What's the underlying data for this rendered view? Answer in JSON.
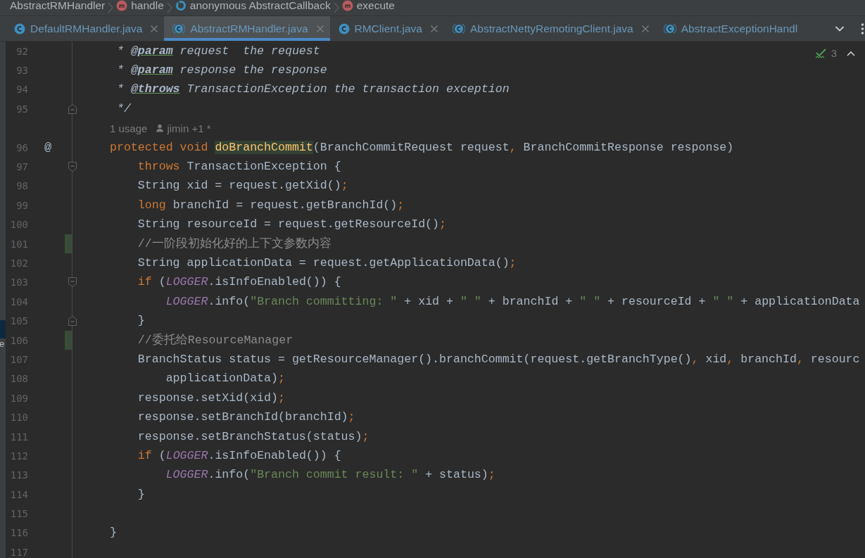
{
  "breadcrumbs": [
    {
      "label": "AbstractRMHandler",
      "kind": "plain"
    },
    {
      "label": "handle",
      "kind": "method"
    },
    {
      "label": "anonymous AbstractCallback",
      "kind": "anonymous"
    },
    {
      "label": "execute",
      "kind": "method"
    }
  ],
  "tabs": [
    {
      "label": "DefaultRMHandler.java",
      "kind": "class",
      "selected": false,
      "closable": true
    },
    {
      "label": "AbstractRMHandler.java",
      "kind": "abstract",
      "selected": true,
      "closable": true
    },
    {
      "label": "RMClient.java",
      "kind": "class",
      "selected": false,
      "closable": true
    },
    {
      "label": "AbstractNettyRemotingClient.java",
      "kind": "abstract",
      "selected": false,
      "closable": true
    },
    {
      "label": "AbstractExceptionHandl",
      "kind": "abstract",
      "selected": false,
      "closable": false
    }
  ],
  "left_stripe": {
    "label": "e"
  },
  "editor": {
    "inspection": {
      "count": "3"
    },
    "lines": [
      {
        "kind": "code",
        "number": "92",
        "tokens": [
          {
            "text": " * ",
            "kind": "doc"
          },
          {
            "text": "@param",
            "kind": "doctag"
          },
          {
            "text": " request  the request",
            "kind": "doc"
          }
        ]
      },
      {
        "kind": "code",
        "number": "93",
        "tokens": [
          {
            "text": " * ",
            "kind": "doc"
          },
          {
            "text": "@param",
            "kind": "doctag"
          },
          {
            "text": " response the response",
            "kind": "doc"
          }
        ]
      },
      {
        "kind": "code",
        "number": "94",
        "tokens": [
          {
            "text": " * ",
            "kind": "doc"
          },
          {
            "text": "@throws",
            "kind": "doctag"
          },
          {
            "text": " TransactionException the transaction exception",
            "kind": "doc"
          }
        ]
      },
      {
        "kind": "code",
        "number": "95",
        "fold_end": true,
        "tokens": [
          {
            "text": " */",
            "kind": "doc"
          }
        ]
      },
      {
        "kind": "inlay",
        "usage": "1 usage",
        "author": "jimin +1 *"
      },
      {
        "kind": "code",
        "number": "96",
        "gutter_mark": "@",
        "tokens": [
          {
            "text": "protected void ",
            "kind": "kw"
          },
          {
            "text": "doBranchCommit",
            "kind": "decl"
          },
          {
            "text": "(BranchCommitRequest request",
            "kind": "plain"
          },
          {
            "text": ", ",
            "kind": "punct"
          },
          {
            "text": "BranchCommitResponse response)",
            "kind": "plain"
          }
        ]
      },
      {
        "kind": "code",
        "number": "97",
        "fold_start": true,
        "tokens": [
          {
            "text": "    throws ",
            "kind": "kw"
          },
          {
            "text": "TransactionException {",
            "kind": "plain"
          }
        ]
      },
      {
        "kind": "code",
        "number": "98",
        "tokens": [
          {
            "text": "    String xid = request.getXid()",
            "kind": "plain"
          },
          {
            "text": ";",
            "kind": "punct"
          }
        ]
      },
      {
        "kind": "code",
        "number": "99",
        "tokens": [
          {
            "text": "    long ",
            "kind": "kw"
          },
          {
            "text": "branchId = request.getBranchId()",
            "kind": "plain"
          },
          {
            "text": ";",
            "kind": "punct"
          }
        ]
      },
      {
        "kind": "code",
        "number": "100",
        "tokens": [
          {
            "text": "    String resourceId = request.getResourceId()",
            "kind": "plain"
          },
          {
            "text": ";",
            "kind": "punct"
          }
        ]
      },
      {
        "kind": "code",
        "number": "101",
        "added": true,
        "tokens": [
          {
            "text": "    //一阶段初始化好的上下文参数内容",
            "kind": "cmt"
          }
        ]
      },
      {
        "kind": "code",
        "number": "102",
        "tokens": [
          {
            "text": "    String applicationData = request.getApplicationData()",
            "kind": "plain"
          },
          {
            "text": ";",
            "kind": "punct"
          }
        ]
      },
      {
        "kind": "code",
        "number": "103",
        "fold_start": true,
        "tokens": [
          {
            "text": "    if ",
            "kind": "kw"
          },
          {
            "text": "(",
            "kind": "plain"
          },
          {
            "text": "LOGGER",
            "kind": "static"
          },
          {
            "text": ".isInfoEnabled()) {",
            "kind": "plain"
          }
        ]
      },
      {
        "kind": "code",
        "number": "104",
        "tokens": [
          {
            "text": "        LOGGER",
            "kind": "static"
          },
          {
            "text": ".info(",
            "kind": "plain"
          },
          {
            "text": "\"Branch committing: \"",
            "kind": "str"
          },
          {
            "text": " + xid + ",
            "kind": "plain"
          },
          {
            "text": "\" \"",
            "kind": "str"
          },
          {
            "text": " + branchId + ",
            "kind": "plain"
          },
          {
            "text": "\" \"",
            "kind": "str"
          },
          {
            "text": " + resourceId + ",
            "kind": "plain"
          },
          {
            "text": "\" \"",
            "kind": "str"
          },
          {
            "text": " + applicationData",
            "kind": "plain"
          }
        ]
      },
      {
        "kind": "code",
        "number": "105",
        "fold_end": true,
        "tokens": [
          {
            "text": "    }",
            "kind": "plain"
          }
        ]
      },
      {
        "kind": "code",
        "number": "106",
        "added": true,
        "tokens": [
          {
            "text": "    //委托给ResourceManager",
            "kind": "cmt"
          }
        ]
      },
      {
        "kind": "code",
        "number": "107",
        "tokens": [
          {
            "text": "    BranchStatus status = getResourceManager().branchCommit(request.getBranchType()",
            "kind": "plain"
          },
          {
            "text": ", ",
            "kind": "punct"
          },
          {
            "text": "xid",
            "kind": "plain"
          },
          {
            "text": ", ",
            "kind": "punct"
          },
          {
            "text": "branchId",
            "kind": "plain"
          },
          {
            "text": ", ",
            "kind": "punct"
          },
          {
            "text": "resourc",
            "kind": "plain"
          }
        ]
      },
      {
        "kind": "code",
        "number": "108",
        "tokens": [
          {
            "text": "        applicationData)",
            "kind": "plain"
          },
          {
            "text": ";",
            "kind": "punct"
          }
        ]
      },
      {
        "kind": "code",
        "number": "109",
        "tokens": [
          {
            "text": "    response.setXid(xid)",
            "kind": "plain"
          },
          {
            "text": ";",
            "kind": "punct"
          }
        ]
      },
      {
        "kind": "code",
        "number": "110",
        "tokens": [
          {
            "text": "    response.setBranchId(branchId)",
            "kind": "plain"
          },
          {
            "text": ";",
            "kind": "punct"
          }
        ]
      },
      {
        "kind": "code",
        "number": "111",
        "tokens": [
          {
            "text": "    response.setBranchStatus(status)",
            "kind": "plain"
          },
          {
            "text": ";",
            "kind": "punct"
          }
        ]
      },
      {
        "kind": "code",
        "number": "112",
        "tokens": [
          {
            "text": "    if ",
            "kind": "kw"
          },
          {
            "text": "(",
            "kind": "plain"
          },
          {
            "text": "LOGGER",
            "kind": "static"
          },
          {
            "text": ".isInfoEnabled()) {",
            "kind": "plain"
          }
        ]
      },
      {
        "kind": "code",
        "number": "113",
        "tokens": [
          {
            "text": "        LOGGER",
            "kind": "static"
          },
          {
            "text": ".info(",
            "kind": "plain"
          },
          {
            "text": "\"Branch commit result: \"",
            "kind": "str"
          },
          {
            "text": " + status)",
            "kind": "plain"
          },
          {
            "text": ";",
            "kind": "punct"
          }
        ]
      },
      {
        "kind": "code",
        "number": "114",
        "tokens": [
          {
            "text": "    }",
            "kind": "plain"
          }
        ]
      },
      {
        "kind": "code",
        "number": "115"
      },
      {
        "kind": "code",
        "number": "116",
        "tokens": [
          {
            "text": "}",
            "kind": "plain"
          }
        ]
      },
      {
        "kind": "code",
        "number": "117"
      }
    ]
  }
}
